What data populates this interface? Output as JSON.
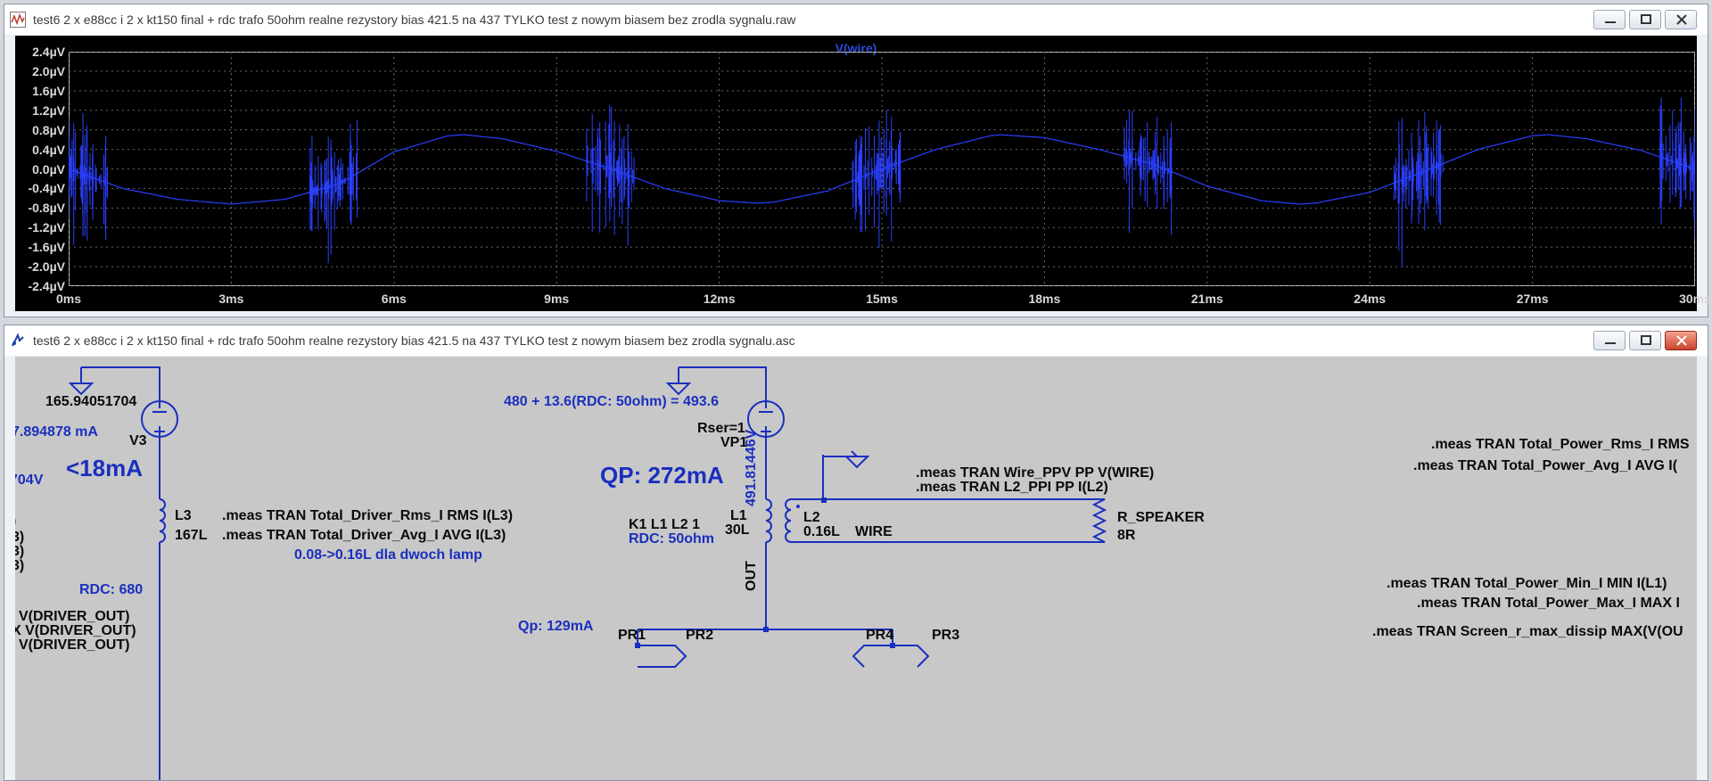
{
  "colors": {
    "trace": "#2a3fff",
    "plot_bg": "#000000",
    "wire": "#1a2fbf",
    "schematic_bg": "#c8c8c8"
  },
  "waveform_window": {
    "title": "test6 2 x e88cc i  2 x kt150 final + rdc trafo 50ohm realne rezystory bias 421.5 na 437 TYLKO test z nowym biasem bez zrodla sygnalu.raw",
    "icon": "waveform-icon"
  },
  "schematic_window": {
    "title": "test6 2 x e88cc i  2 x kt150 final + rdc trafo 50ohm realne rezystory bias 421.5 na 437 TYLKO test z nowym biasem bez zrodla sygnalu.asc",
    "icon": "schematic-icon"
  },
  "chart_data": {
    "type": "line",
    "title": "V(wire)",
    "xlabel": "",
    "ylabel": "",
    "x_unit": "ms",
    "y_unit": "µV",
    "xlim": [
      0,
      30
    ],
    "ylim": [
      -2.4,
      2.4
    ],
    "x_ticks": [
      "0ms",
      "3ms",
      "6ms",
      "9ms",
      "12ms",
      "15ms",
      "18ms",
      "21ms",
      "24ms",
      "27ms",
      "30ms"
    ],
    "y_ticks": [
      "2.4µV",
      "2.0µV",
      "1.6µV",
      "1.2µV",
      "0.8µV",
      "0.4µV",
      "0.0µV",
      "-0.4µV",
      "-0.8µV",
      "-1.2µV",
      "-1.6µV",
      "-2.0µV",
      "-2.4µV"
    ],
    "grid": true,
    "series": [
      {
        "name": "V(wire)",
        "x": [
          0,
          1,
          2,
          3,
          4,
          5,
          6,
          7,
          7.3,
          8,
          9,
          10,
          11,
          12,
          12.7,
          13,
          14,
          15,
          16,
          17,
          17.2,
          18,
          19,
          20,
          21,
          22,
          22.7,
          23,
          24,
          25,
          26,
          27,
          27.3,
          28,
          29,
          30
        ],
        "y": [
          0.0,
          -0.4,
          -0.62,
          -0.72,
          -0.62,
          -0.3,
          0.35,
          0.68,
          0.7,
          0.62,
          0.36,
          0.0,
          -0.4,
          -0.65,
          -0.7,
          -0.68,
          -0.45,
          0.0,
          0.4,
          0.68,
          0.7,
          0.64,
          0.4,
          0.1,
          -0.35,
          -0.65,
          -0.72,
          -0.7,
          -0.48,
          -0.05,
          0.4,
          0.68,
          0.7,
          0.62,
          0.38,
          0.0
        ]
      }
    ],
    "noise_bursts_ms": [
      0.3,
      4.9,
      10.0,
      14.9,
      19.9,
      24.9,
      29.8
    ]
  },
  "schematic": {
    "v3_value": "165.94051704",
    "v3_name": "V3",
    "v3_current": "7.894878 mA",
    "lt18": "<18mA",
    "v_frag": "704V",
    "l3_name": "L3",
    "l3_value": "167L",
    "meas_driver_rms": ".meas TRAN Total_Driver_Rms_I RMS I(L3)",
    "meas_driver_avg": ".meas TRAN Total_Driver_Avg_I AVG I(L3)",
    "note_l": "0.08->0.16L dla dwoch lamp",
    "paren1": ")",
    "paren2": "3)",
    "paren3": "3)",
    "paren4": "3)",
    "rdc680": "RDC: 680",
    "drv1": "V(DRIVER_OUT)",
    "drv2": "X V(DRIVER_OUT)",
    "drv3": "V(DRIVER_OUT)",
    "vp1_value": "480 + 13.6(RDC: 50ohm) = 493.6",
    "rser": "Rser=1",
    "vp1_name": "VP1",
    "qp": "QP: 272mA",
    "vp1_node": "491.81446V",
    "out": "OUT",
    "k1": "K1 L1 L2 1",
    "rdc50": "RDC: 50ohm",
    "l1_name": "L1",
    "l1_value": "30L",
    "l2_name": "L2",
    "l2_value": "0.16L",
    "wire": "WIRE",
    "rspk_name": "R_SPEAKER",
    "rspk_value": "8R",
    "meas_wire": ".meas TRAN Wire_PPV PP V(WIRE)",
    "meas_l2": ".meas TRAN L2_PPI PP I(L2)",
    "meas_pow_rms": ".meas TRAN Total_Power_Rms_I RMS",
    "meas_pow_avg": ".meas TRAN Total_Power_Avg_I AVG I(",
    "meas_pow_min": ".meas TRAN Total_Power_Min_I MIN I(L1)",
    "meas_pow_max": ".meas TRAN Total_Power_Max_I MAX I",
    "meas_screen": ".meas TRAN Screen_r_max_dissip MAX(V(OU",
    "qp2": "Qp: 129mA",
    "pr1": "PR1",
    "pr2": "PR2",
    "pr4": "PR4",
    "pr3": "PR3"
  }
}
